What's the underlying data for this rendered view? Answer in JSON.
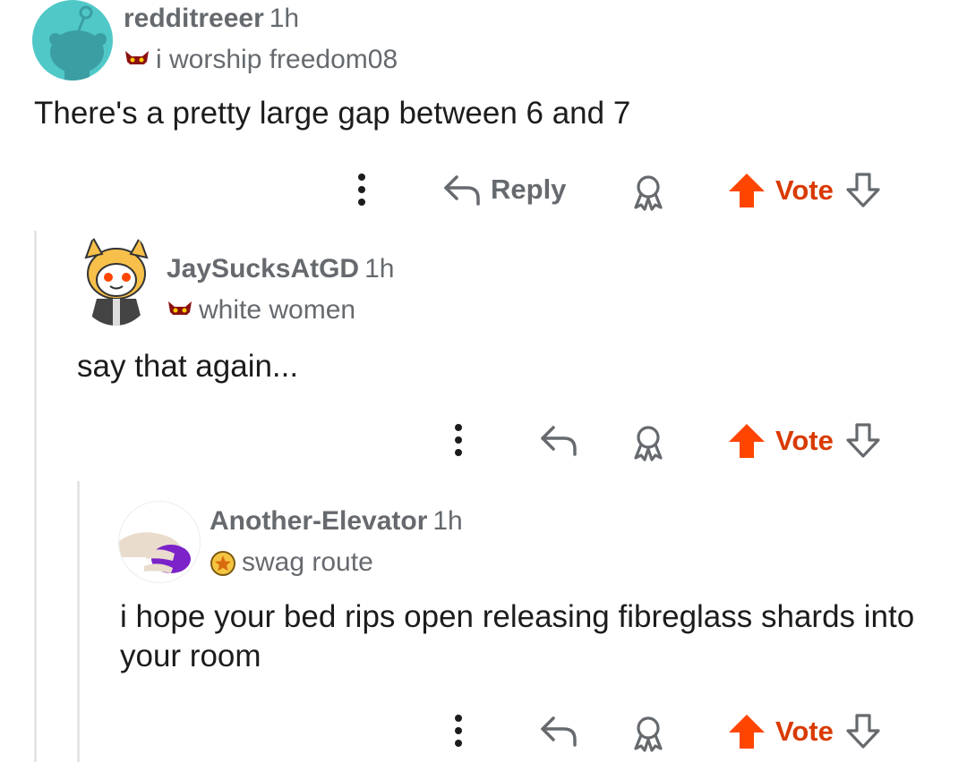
{
  "colors": {
    "accent": "#ff4500",
    "vote_text": "#d93a00",
    "muted": "#666a6e",
    "thread_line": "#e4e5e7"
  },
  "comments": [
    {
      "username": "redditreeer",
      "time": "1h",
      "flair": "i worship freedom08",
      "flair_icon": "demon-face-icon",
      "body": "There's a pretty large gap between 6 and 7",
      "actions": {
        "reply_label": "Reply",
        "vote_label": "Vote"
      }
    },
    {
      "username": "JaySucksAtGD",
      "time": "1h",
      "flair": "white women",
      "flair_icon": "demon-face-icon",
      "body": "say that again...",
      "actions": {
        "vote_label": "Vote"
      }
    },
    {
      "username": "Another-Elevator",
      "time": "1h",
      "flair": "swag route",
      "flair_icon": "star-coin-icon",
      "body": "i hope your bed rips open releasing fibreglass shards into your room",
      "actions": {
        "vote_label": "Vote"
      }
    }
  ]
}
